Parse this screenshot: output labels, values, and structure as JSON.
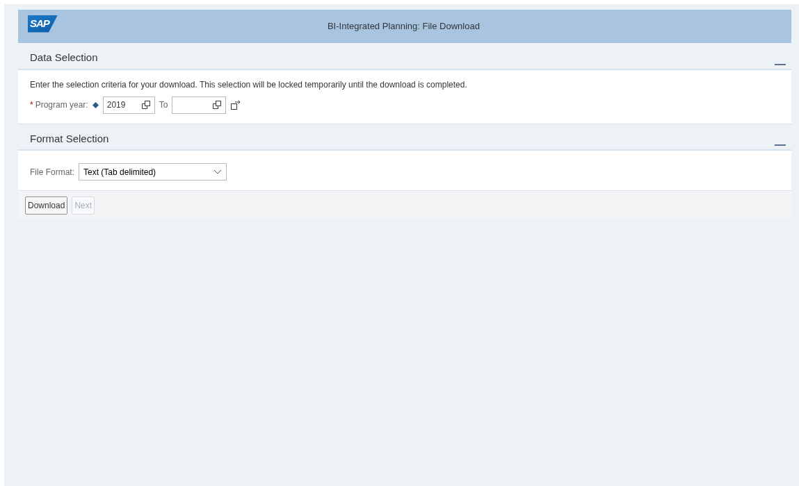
{
  "header": {
    "logo": "SAP",
    "title": "BI-Integrated Planning: File Download"
  },
  "sections": [
    {
      "title": "Data Selection",
      "expanded": true,
      "kind": "range",
      "intro": "Enter the selection criteria for your download. This selection will be locked temporarily until the download is completed.",
      "label": "Program year:",
      "required_mark": "*",
      "from": "2019",
      "to_label": "To"
    },
    {
      "title": "Format Selection",
      "expanded": true,
      "kind": "dropdown",
      "label": "File Format:",
      "value": "Text (Tab delimited)"
    }
  ],
  "buttons": [
    {
      "label": "Download",
      "disabled": false
    },
    {
      "label": "Next",
      "disabled": true
    }
  ]
}
